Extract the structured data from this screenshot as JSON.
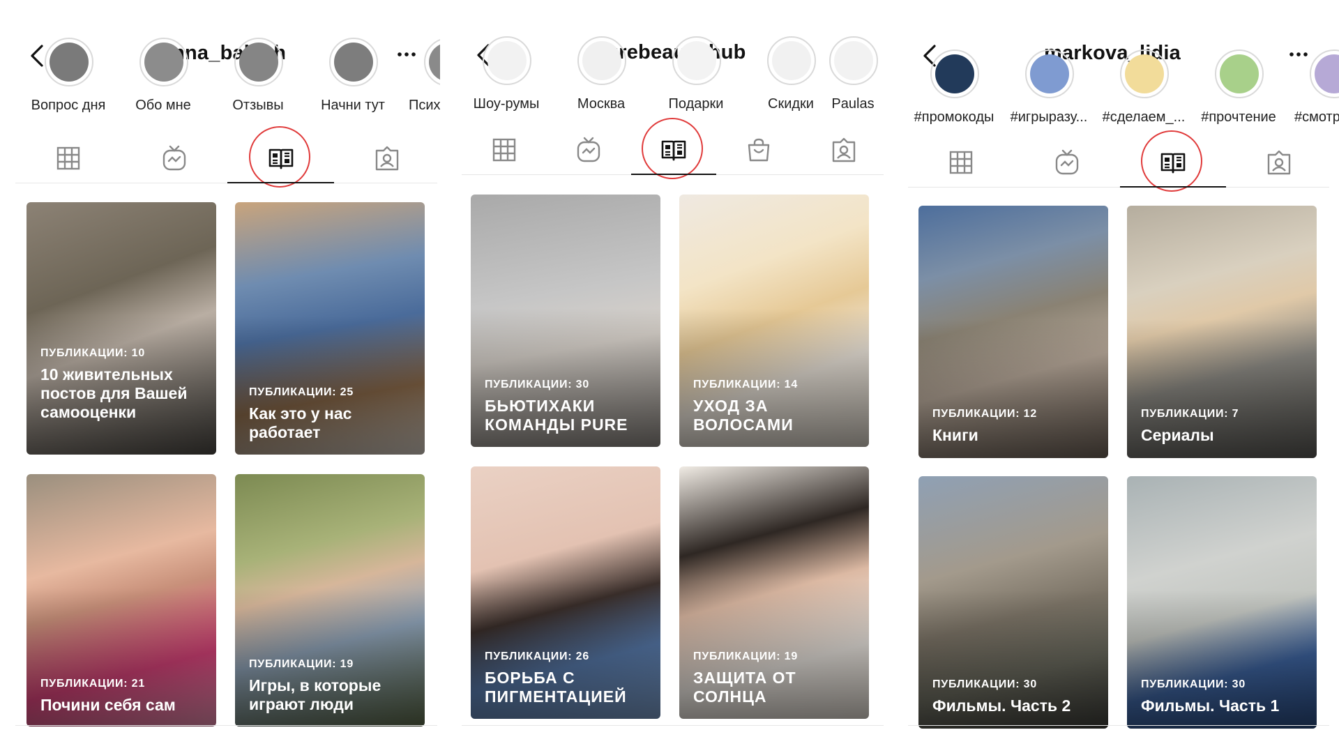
{
  "panels": [
    {
      "username": "anna_babich",
      "highlights": [
        "Вопрос дня",
        "Обо мне",
        "Отзывы",
        "Начни тут",
        "Психо"
      ],
      "guides": [
        {
          "count": "ПУБЛИКАЦИИ: 10",
          "title": "10 живительных постов для Вашей самооценки"
        },
        {
          "count": "ПУБЛИКАЦИИ: 25",
          "title": "Как это у нас работает"
        },
        {
          "count": "ПУБЛИКАЦИИ: 21",
          "title": "Почини себя сам"
        },
        {
          "count": "ПУБЛИКАЦИИ: 19",
          "title": "Игры, в которые играют люди"
        }
      ]
    },
    {
      "username": "purebeauty.hub",
      "highlights": [
        "Шоу-румы",
        "Москва",
        "Подарки",
        "Скидки",
        "Paulas"
      ],
      "guides": [
        {
          "count": "ПУБЛИКАЦИИ: 30",
          "title": "БЬЮТИХАКИ КОМАНДЫ PURE"
        },
        {
          "count": "ПУБЛИКАЦИИ: 14",
          "title": "УХОД ЗА ВОЛОСАМИ"
        },
        {
          "count": "ПУБЛИКАЦИИ: 26",
          "title": "БОРЬБА С ПИГМЕНТАЦИЕЙ"
        },
        {
          "count": "ПУБЛИКАЦИИ: 19",
          "title": "ЗАЩИТА ОТ СОЛНЦА"
        }
      ]
    },
    {
      "username": "markova_lidia",
      "highlights": [
        "#промокоды",
        "#игрыразу...",
        "#сделаем_...",
        "#прочтение",
        "#смотр"
      ],
      "guides": [
        {
          "count": "ПУБЛИКАЦИИ: 12",
          "title": "Книги"
        },
        {
          "count": "ПУБЛИКАЦИИ: 7",
          "title": "Сериалы"
        },
        {
          "count": "ПУБЛИКАЦИИ: 30",
          "title": "Фильмы. Часть 2"
        },
        {
          "count": "ПУБЛИКАЦИИ: 30",
          "title": "Фильмы. Часть 1"
        }
      ]
    }
  ],
  "tabs_panel_1_3": [
    "grid-icon",
    "igtv-icon",
    "guides-icon",
    "tagged-icon"
  ],
  "tabs_panel_2": [
    "grid-icon",
    "igtv-icon",
    "guides-icon",
    "shop-icon",
    "tagged-icon"
  ],
  "active_tab": "guides-icon",
  "colors": {
    "highlight_circle": "#e03a3a",
    "text": "#111111",
    "divider": "#e6e6e6"
  }
}
